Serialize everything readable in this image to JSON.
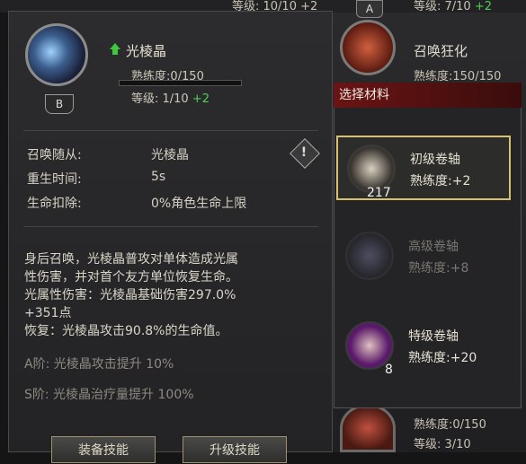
{
  "background": {
    "top_level_left": "等级: 10/10 +2",
    "top_level_right": "等级: 7/10",
    "top_level_right_plus": "+2",
    "grade_a": "A",
    "summon_rage": {
      "name": "召唤狂化",
      "proficiency": "熟练度:150/150"
    },
    "bottom_proficiency": "熟练度:0/150",
    "bottom_level": "等级: 3/10"
  },
  "skill": {
    "name": "光棱晶",
    "grade": "B",
    "proficiency": "熟练度:0/150",
    "proficiency_fraction": 0.0,
    "level": "等级: 1/10",
    "level_plus": "+2",
    "stats": [
      {
        "label": "召唤随从:",
        "value": "光棱晶"
      },
      {
        "label": "重生时间:",
        "value": "5s"
      },
      {
        "label": "生命扣除:",
        "value": "0%角色生命上限"
      }
    ],
    "description_lines": [
      "身后召唤，光棱晶普攻对单体造成光属",
      "性伤害，并对首个友方单位恢复生命。",
      "光属性伤害：光棱晶基础伤害297.0%",
      "+351点",
      "恢复：光棱晶攻击90.8%的生命值。"
    ],
    "tier_a": "A阶: 光棱晶攻击提升 10%",
    "tier_s": "S阶: 光棱晶治疗量提升 100%"
  },
  "buttons": {
    "equip": "装备技能",
    "upgrade": "升级技能"
  },
  "materials": {
    "header": "选择材料",
    "items": [
      {
        "name": "初级卷轴",
        "proficiency": "熟练度:+2",
        "count": "217"
      },
      {
        "name": "高级卷轴",
        "proficiency": "熟练度:+8",
        "count": ""
      },
      {
        "name": "特级卷轴",
        "proficiency": "熟练度:+20",
        "count": "8"
      }
    ]
  },
  "colors": {
    "accent_green": "#4fcf4f",
    "selected_border": "#d8c070",
    "header_red": "#6a1414"
  }
}
